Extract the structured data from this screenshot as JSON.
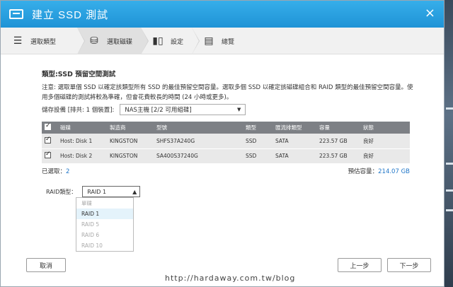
{
  "window": {
    "title": "建立 SSD 測試",
    "close": "×"
  },
  "steps": [
    {
      "label": "選取類型",
      "icon": "list-icon"
    },
    {
      "label": "選取磁碟",
      "icon": "disk-icon"
    },
    {
      "label": "設定",
      "icon": "settings-icon"
    },
    {
      "label": "總覽",
      "icon": "summary-icon"
    }
  ],
  "content": {
    "heading": "類型:SSD 預留空間測試",
    "notice": "注意: 選取單個 SSD 以確定該類型所有 SSD 的最佳預留空間容量。選取多個 SSD 以確定該磁碟組合和 RAID 類型的最佳預留空間容量。使用多個磁碟的測試將較為準確，但會花費較長的時間 (24 小時或更多)。",
    "pool_label": "儲存設備 [排共: 1 個裝置]:",
    "pool_value": "NAS主機 [2/2 可用組碟]"
  },
  "table": {
    "headers": [
      "磁碟",
      "製造商",
      "型號",
      "類型",
      "匯流排類型",
      "容量",
      "狀態"
    ],
    "rows": [
      {
        "disk": "Host: Disk 1",
        "vendor": "KINGSTON",
        "model": "SHFS37A240G",
        "type": "SSD",
        "bus": "SATA",
        "capacity": "223.57 GB",
        "status": "良好",
        "checked": true
      },
      {
        "disk": "Host: Disk 2",
        "vendor": "KINGSTON",
        "model": "SA400S37240G",
        "type": "SSD",
        "bus": "SATA",
        "capacity": "223.57 GB",
        "status": "良好",
        "checked": true
      }
    ]
  },
  "summary": {
    "selected_label": "已選取：",
    "selected_count": "2",
    "estimate_label": "預估容量：",
    "estimate_value": "214.07 GB"
  },
  "raid": {
    "label": "RAID類型：",
    "value": "RAID 1",
    "options": [
      "單碟",
      "RAID 1",
      "RAID 5",
      "RAID 6",
      "RAID 10"
    ]
  },
  "buttons": {
    "cancel": "取消",
    "back": "上一步",
    "next": "下一步"
  },
  "watermark": "http://hardaway.com.tw/blog"
}
